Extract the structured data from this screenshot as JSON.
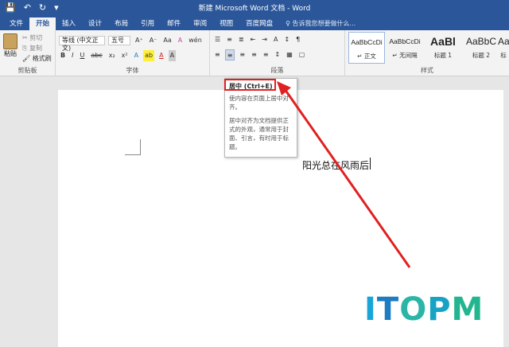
{
  "window": {
    "title": "新建 Microsoft Word 文档 - Word"
  },
  "qat": {
    "save": "💾",
    "undo": "↶",
    "redo": "↻",
    "more": "▾"
  },
  "tabs": [
    {
      "label": "文件"
    },
    {
      "label": "开始"
    },
    {
      "label": "插入"
    },
    {
      "label": "设计"
    },
    {
      "label": "布局"
    },
    {
      "label": "引用"
    },
    {
      "label": "邮件"
    },
    {
      "label": "审阅"
    },
    {
      "label": "视图"
    },
    {
      "label": "百度网盘"
    }
  ],
  "tell_me": "♀ 告诉我您想要做什么...",
  "clipboard": {
    "paste": "粘贴",
    "cut": "剪切",
    "copy": "复制",
    "format_painter": "格式刷",
    "label": "剪贴板"
  },
  "font": {
    "name": "等线 (中文正文)",
    "size": "五号",
    "grow": "A⁺",
    "shrink": "A⁻",
    "case": "Aa",
    "clear": "A",
    "wen": "wén",
    "bold": "B",
    "italic": "I",
    "underline": "U",
    "strike": "abc",
    "sub": "x₂",
    "sup": "x²",
    "effects": "A",
    "highlight": "ab",
    "color": "A",
    "shade": "A",
    "label": "字体"
  },
  "paragraph": {
    "bullets": "☰",
    "numbering": "≡",
    "multilevel": "≣",
    "dec_indent": "⇤",
    "inc_indent": "⇥",
    "chinese_layout": "A",
    "sort": "↕",
    "show_marks": "¶",
    "align_left": "≡",
    "align_center": "≡",
    "align_right": "≡",
    "justify": "≡",
    "distributed": "≡",
    "line_spacing": "↕",
    "shading": "▦",
    "borders": "▢",
    "label": "段落"
  },
  "styles": {
    "items": [
      {
        "sample": "AaBbCcDi",
        "name": "↵ 正文"
      },
      {
        "sample": "AaBbCcDi",
        "name": "↵ 无间隔"
      },
      {
        "sample": "AaBl",
        "name": "标题 1"
      },
      {
        "sample": "AaBbC",
        "name": "标题 2"
      },
      {
        "sample": "AaB",
        "name": "标"
      }
    ],
    "label": "样式"
  },
  "tooltip": {
    "title": "居中 (Ctrl+E)",
    "desc": "使内容在页面上居中对齐。",
    "desc2": "居中对齐为文档提供正式的外观，通常用于封面、引言，有时用于标题。"
  },
  "document": {
    "text": "阳光总在风雨后"
  },
  "watermark": {
    "l1": "I",
    "l2": "T",
    "l3": "O",
    "l4": "P",
    "l5": "M"
  },
  "colors": {
    "ribbon_blue": "#2b579a",
    "highlight_red": "#e02020"
  }
}
